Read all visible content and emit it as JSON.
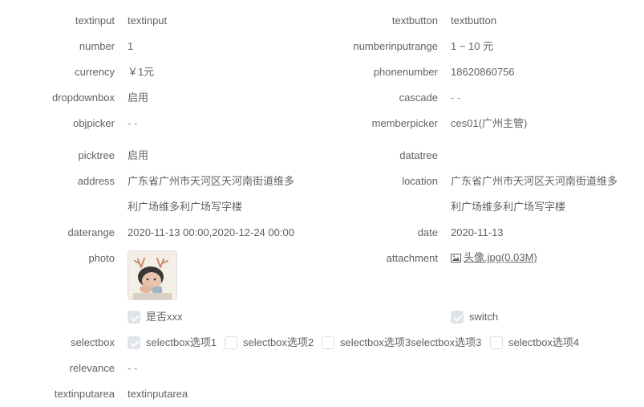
{
  "rows": {
    "textinput": {
      "label": "textinput",
      "value": "textinput"
    },
    "textbutton": {
      "label": "textbutton",
      "value": "textbutton"
    },
    "number": {
      "label": "number",
      "value": "1"
    },
    "numberinputrange": {
      "label": "numberinputrange",
      "value": "1 ~ 10 元"
    },
    "currency": {
      "label": "currency",
      "value": "￥1元"
    },
    "phonenumber": {
      "label": "phonenumber",
      "value": "18620860756"
    },
    "dropdownbox": {
      "label": "dropdownbox",
      "value": "启用"
    },
    "cascade": {
      "label": "cascade",
      "value": "- -"
    },
    "objpicker": {
      "label": "objpicker",
      "value": "- -"
    },
    "memberpicker": {
      "label": "memberpicker",
      "value": "ces01(广州主管)"
    },
    "picktree": {
      "label": "picktree",
      "value": "启用"
    },
    "datatree": {
      "label": "datatree",
      "value": ""
    },
    "address": {
      "label": "address",
      "line1": "广东省广州市天河区天河南街道维多",
      "line2": "利广场维多利广场写字楼"
    },
    "location": {
      "label": "location",
      "line1": "广东省广州市天河区天河南街道维多",
      "line2": "利广场维多利广场写字楼"
    },
    "daterange": {
      "label": "daterange",
      "value": "2020-11-13 00:00,2020-12-24 00:00"
    },
    "date": {
      "label": "date",
      "value": "2020-11-13"
    },
    "photo": {
      "label": "photo"
    },
    "attachment": {
      "label": "attachment",
      "file": "头像.jpg(0.03M)"
    },
    "checkbox": {
      "text": "是否xxx",
      "checked": true
    },
    "switch": {
      "text": "switch",
      "checked": true
    },
    "selectbox": {
      "label": "selectbox",
      "options": [
        {
          "text": "selectbox选项1",
          "checked": true
        },
        {
          "text": "selectbox选项2",
          "checked": false
        },
        {
          "text": "selectbox选项3selectbox选项3",
          "checked": false
        },
        {
          "text": "selectbox选项4",
          "checked": false
        }
      ]
    },
    "relevance": {
      "label": "relevance",
      "value": "- -"
    },
    "textinputarea": {
      "label": "textinputarea",
      "value": "textinputarea"
    }
  },
  "colors": {
    "label": "#606266",
    "muted": "#909399",
    "checkbox_on": "#dfe3ea",
    "border": "#dcdfe6"
  }
}
